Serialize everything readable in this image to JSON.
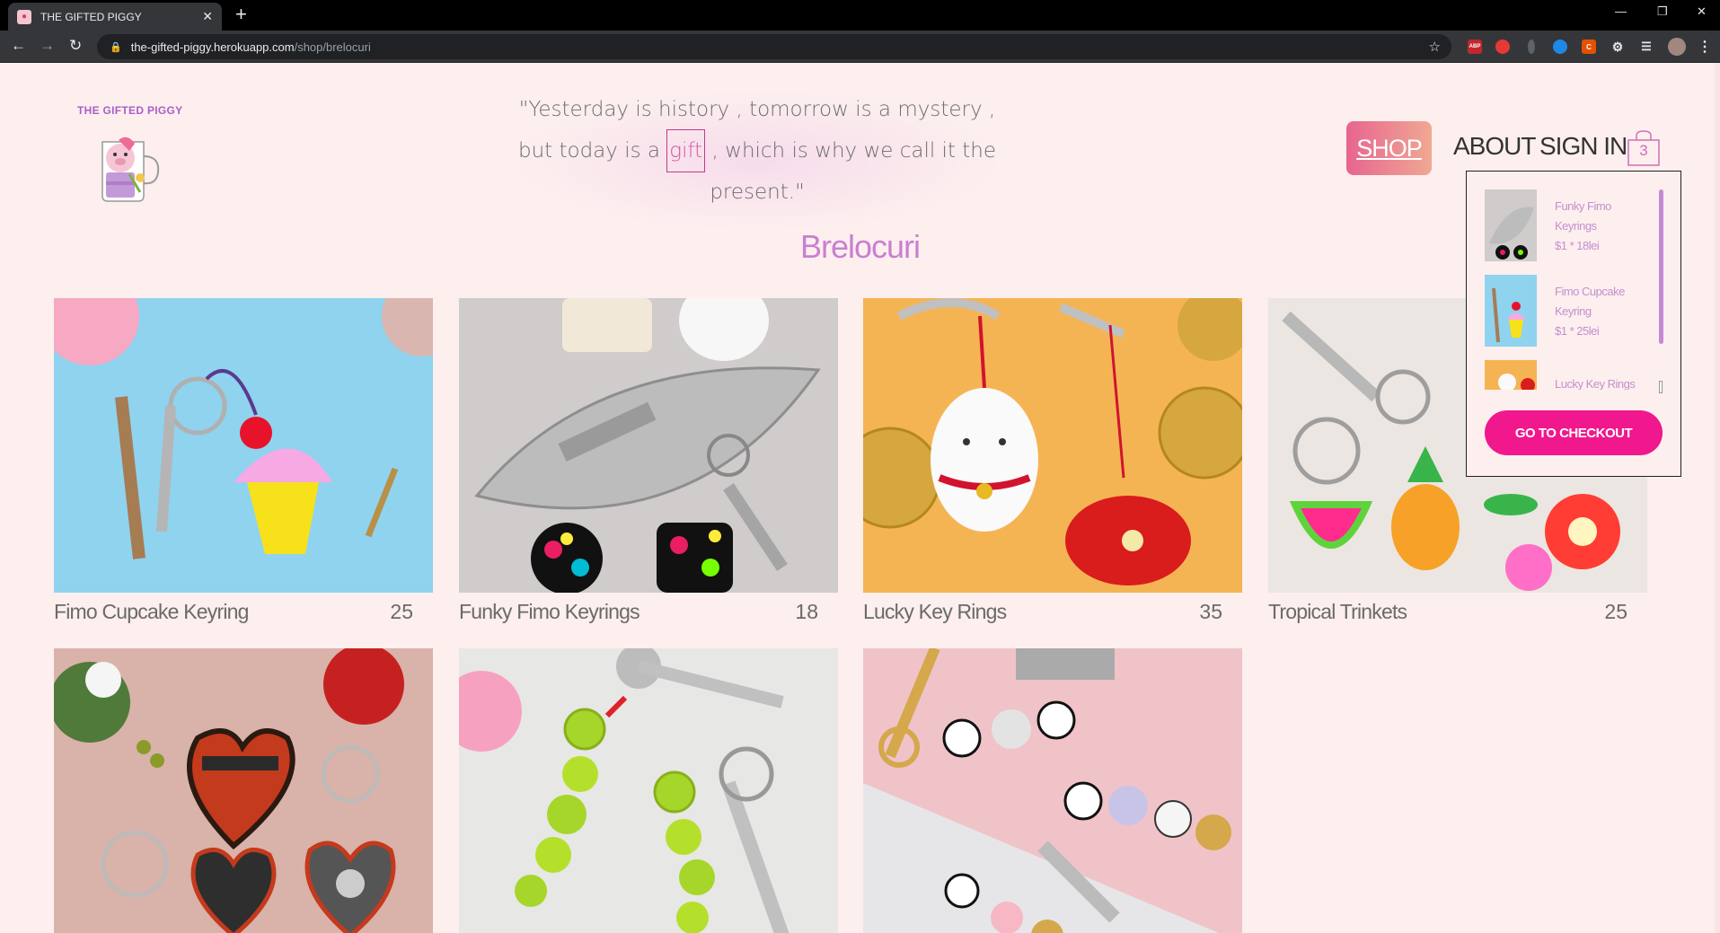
{
  "browser": {
    "tab_title": "THE GIFTED PIGGY",
    "url_host": "the-gifted-piggy.herokuapp.com",
    "url_path": "/shop/brelocuri"
  },
  "header": {
    "logo_text": "THE GIFTED PIGGY",
    "quote_before": "\"Yesterday is history , tomorrow is a mystery , but today is a",
    "quote_highlight": "gift",
    "quote_after": ", which is why we call it the present.\"",
    "nav": {
      "shop": "SHOP",
      "about": "ABOUT",
      "sign_in": "SIGN IN",
      "cart_count": "3"
    }
  },
  "main": {
    "title": "Brelocuri",
    "products": [
      {
        "name": "Fimo Cupcake Keyring",
        "price": "25"
      },
      {
        "name": "Funky Fimo Keyrings",
        "price": "18"
      },
      {
        "name": "Lucky Key Rings",
        "price": "35"
      },
      {
        "name": "Tropical Trinkets",
        "price": "25"
      },
      {
        "name": "",
        "price": ""
      },
      {
        "name": "",
        "price": ""
      },
      {
        "name": "",
        "price": ""
      }
    ]
  },
  "cart_dropdown": {
    "items": [
      {
        "name": "Funky Fimo Keyrings",
        "qty_price": "$1 * 18lei"
      },
      {
        "name": "Fimo Cupcake Keyring",
        "qty_price": "$1 * 25lei"
      },
      {
        "name": "Lucky Key Rings",
        "qty_price": ""
      }
    ],
    "checkout_label": "GO TO CHECKOUT"
  },
  "colors": {
    "accent_pink": "#f0188c",
    "title_purple": "#c97fd1",
    "page_bg": "#fcefee"
  }
}
